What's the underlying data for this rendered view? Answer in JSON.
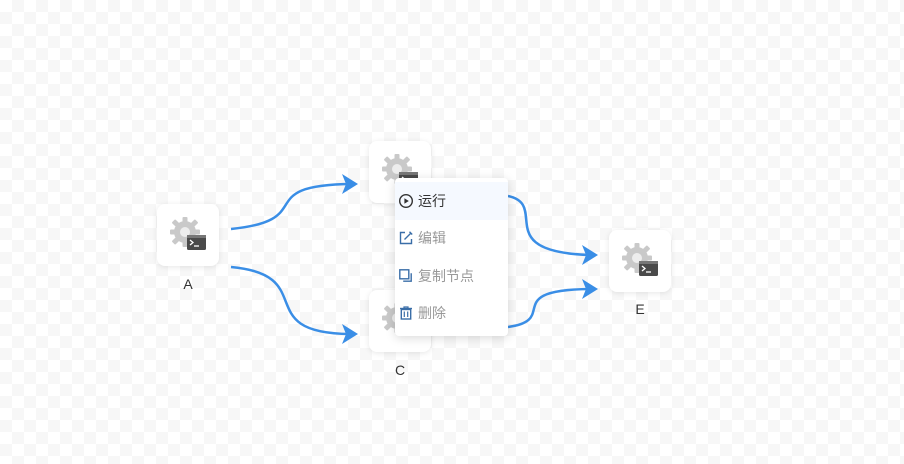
{
  "nodes": [
    {
      "id": "A",
      "label": "A"
    },
    {
      "id": "B",
      "label": ""
    },
    {
      "id": "C",
      "label": "C"
    },
    {
      "id": "D",
      "label": ""
    },
    {
      "id": "E",
      "label": "E"
    }
  ],
  "edge_color": "#3a8ee6",
  "node_icon": "gear-terminal-icon",
  "context_menu": {
    "items": [
      {
        "label": "运行",
        "icon": "play-circle-icon"
      },
      {
        "label": "编辑",
        "icon": "edit-icon"
      },
      {
        "label": "复制节点",
        "icon": "copy-icon"
      },
      {
        "label": "删除",
        "icon": "trash-icon"
      }
    ]
  }
}
